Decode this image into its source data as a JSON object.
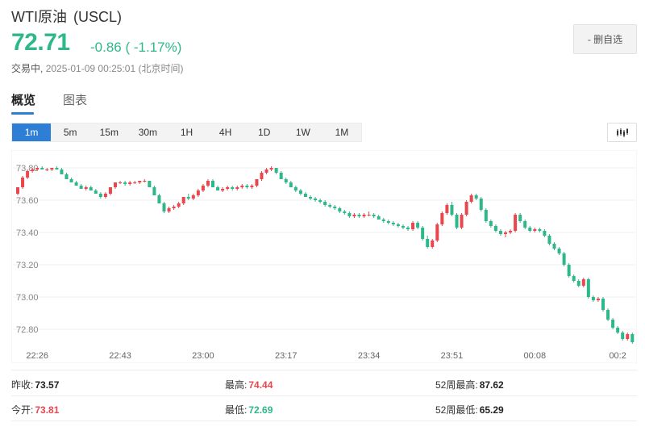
{
  "header": {
    "name": "WTI原油",
    "code": "(USCL)",
    "price": "72.71",
    "change": "-0.86 ( -1.17%)",
    "status": "交易中,",
    "timestamp": "2025-01-09 00:25:01 (北京时间)",
    "fav_label": "- 删自选"
  },
  "tabs": [
    {
      "label": "概览",
      "active": true
    },
    {
      "label": "图表",
      "active": false
    }
  ],
  "periods": [
    "1m",
    "5m",
    "15m",
    "30m",
    "1H",
    "4H",
    "1D",
    "1W",
    "1M"
  ],
  "active_period": "1m",
  "colors": {
    "up": "#e8474e",
    "down": "#2eb88a",
    "accent": "#2d7fd6"
  },
  "stats": {
    "prev_close_label": "昨收:",
    "prev_close": "73.57",
    "open_label": "今开:",
    "open": "73.81",
    "high_label": "最高:",
    "high": "74.44",
    "low_label": "最低:",
    "low": "72.69",
    "w52_high_label": "52周最高:",
    "w52_high": "87.62",
    "w52_low_label": "52周最低:",
    "w52_low": "65.29"
  },
  "chart_data": {
    "type": "candlestick",
    "y_ticks": [
      "73.80",
      "73.60",
      "73.40",
      "73.20",
      "73.00",
      "72.80"
    ],
    "y_tick_values": [
      73.8,
      73.6,
      73.4,
      73.2,
      73.0,
      72.8
    ],
    "ylim": [
      72.71,
      73.87
    ],
    "x_ticks": [
      "22:26",
      "22:43",
      "23:00",
      "23:17",
      "23:34",
      "23:51",
      "00:08",
      "00:2"
    ],
    "x_tick_index": [
      4,
      21,
      38,
      55,
      72,
      89,
      106,
      123
    ],
    "grid": true,
    "candles": [
      [
        73.64,
        73.68,
        73.63,
        73.68
      ],
      [
        73.68,
        73.75,
        73.67,
        73.74
      ],
      [
        73.74,
        73.79,
        73.73,
        73.78
      ],
      [
        73.78,
        73.8,
        73.77,
        73.79
      ],
      [
        73.79,
        73.8,
        73.78,
        73.8
      ],
      [
        73.8,
        73.81,
        73.79,
        73.79
      ],
      [
        73.79,
        73.8,
        73.78,
        73.79
      ],
      [
        73.79,
        73.8,
        73.78,
        73.8
      ],
      [
        73.8,
        73.81,
        73.79,
        73.79
      ],
      [
        73.79,
        73.8,
        73.76,
        73.76
      ],
      [
        73.76,
        73.77,
        73.73,
        73.73
      ],
      [
        73.73,
        73.74,
        73.71,
        73.71
      ],
      [
        73.71,
        73.72,
        73.69,
        73.69
      ],
      [
        73.69,
        73.7,
        73.67,
        73.67
      ],
      [
        73.67,
        73.69,
        73.66,
        73.68
      ],
      [
        73.68,
        73.69,
        73.66,
        73.66
      ],
      [
        73.66,
        73.67,
        73.64,
        73.64
      ],
      [
        73.64,
        73.65,
        73.61,
        73.62
      ],
      [
        73.62,
        73.65,
        73.61,
        73.64
      ],
      [
        73.64,
        73.68,
        73.63,
        73.68
      ],
      [
        73.68,
        73.71,
        73.67,
        73.71
      ],
      [
        73.71,
        73.72,
        73.7,
        73.71
      ],
      [
        73.71,
        73.72,
        73.69,
        73.7
      ],
      [
        73.7,
        73.72,
        73.69,
        73.71
      ],
      [
        73.71,
        73.72,
        73.7,
        73.71
      ],
      [
        73.71,
        73.72,
        73.7,
        73.72
      ],
      [
        73.72,
        73.73,
        73.71,
        73.72
      ],
      [
        73.72,
        73.72,
        73.68,
        73.68
      ],
      [
        73.68,
        73.69,
        73.63,
        73.63
      ],
      [
        73.63,
        73.64,
        73.58,
        73.58
      ],
      [
        73.58,
        73.59,
        73.52,
        73.53
      ],
      [
        73.53,
        73.56,
        73.52,
        73.55
      ],
      [
        73.55,
        73.57,
        73.54,
        73.56
      ],
      [
        73.56,
        73.59,
        73.55,
        73.58
      ],
      [
        73.58,
        73.62,
        73.57,
        73.62
      ],
      [
        73.62,
        73.64,
        73.6,
        73.61
      ],
      [
        73.61,
        73.64,
        73.6,
        73.63
      ],
      [
        73.63,
        73.67,
        73.62,
        73.66
      ],
      [
        73.66,
        73.7,
        73.65,
        73.69
      ],
      [
        73.69,
        73.73,
        73.68,
        73.72
      ],
      [
        73.72,
        73.73,
        73.68,
        73.68
      ],
      [
        73.68,
        73.69,
        73.66,
        73.66
      ],
      [
        73.66,
        73.68,
        73.65,
        73.67
      ],
      [
        73.67,
        73.69,
        73.66,
        73.68
      ],
      [
        73.68,
        73.69,
        73.66,
        73.67
      ],
      [
        73.67,
        73.69,
        73.66,
        73.68
      ],
      [
        73.68,
        73.7,
        73.67,
        73.69
      ],
      [
        73.69,
        73.7,
        73.67,
        73.68
      ],
      [
        73.68,
        73.7,
        73.67,
        73.69
      ],
      [
        73.69,
        73.73,
        73.68,
        73.73
      ],
      [
        73.73,
        73.78,
        73.72,
        73.77
      ],
      [
        73.77,
        73.8,
        73.76,
        73.79
      ],
      [
        73.79,
        73.81,
        73.78,
        73.8
      ],
      [
        73.8,
        73.8,
        73.76,
        73.77
      ],
      [
        73.77,
        73.78,
        73.73,
        73.73
      ],
      [
        73.73,
        73.74,
        73.7,
        73.71
      ],
      [
        73.71,
        73.72,
        73.68,
        73.68
      ],
      [
        73.68,
        73.69,
        73.65,
        73.66
      ],
      [
        73.66,
        73.67,
        73.63,
        73.64
      ],
      [
        73.64,
        73.65,
        73.62,
        73.62
      ],
      [
        73.62,
        73.63,
        73.6,
        73.61
      ],
      [
        73.61,
        73.62,
        73.59,
        73.6
      ],
      [
        73.6,
        73.61,
        73.58,
        73.59
      ],
      [
        73.59,
        73.6,
        73.56,
        73.57
      ],
      [
        73.57,
        73.58,
        73.55,
        73.56
      ],
      [
        73.56,
        73.57,
        73.54,
        73.55
      ],
      [
        73.55,
        73.56,
        73.52,
        73.53
      ],
      [
        73.53,
        73.54,
        73.51,
        73.52
      ],
      [
        73.52,
        73.53,
        73.49,
        73.5
      ],
      [
        73.5,
        73.52,
        73.49,
        73.51
      ],
      [
        73.51,
        73.52,
        73.49,
        73.5
      ],
      [
        73.5,
        73.52,
        73.49,
        73.51
      ],
      [
        73.51,
        73.53,
        73.5,
        73.51
      ],
      [
        73.51,
        73.52,
        73.49,
        73.5
      ],
      [
        73.5,
        73.51,
        73.48,
        73.48
      ],
      [
        73.48,
        73.49,
        73.46,
        73.47
      ],
      [
        73.47,
        73.48,
        73.45,
        73.46
      ],
      [
        73.46,
        73.47,
        73.44,
        73.45
      ],
      [
        73.45,
        73.46,
        73.43,
        73.44
      ],
      [
        73.44,
        73.45,
        73.42,
        73.43
      ],
      [
        73.43,
        73.44,
        73.41,
        73.42
      ],
      [
        73.42,
        73.47,
        73.41,
        73.46
      ],
      [
        73.46,
        73.47,
        73.42,
        73.43
      ],
      [
        73.43,
        73.44,
        73.35,
        73.36
      ],
      [
        73.36,
        73.38,
        73.3,
        73.31
      ],
      [
        73.31,
        73.36,
        73.3,
        73.35
      ],
      [
        73.35,
        73.46,
        73.34,
        73.45
      ],
      [
        73.45,
        73.53,
        73.44,
        73.52
      ],
      [
        73.52,
        73.58,
        73.51,
        73.57
      ],
      [
        73.57,
        73.59,
        73.5,
        73.51
      ],
      [
        73.51,
        73.52,
        73.42,
        73.43
      ],
      [
        73.43,
        73.52,
        73.42,
        73.51
      ],
      [
        73.51,
        73.6,
        73.5,
        73.59
      ],
      [
        73.59,
        73.64,
        73.58,
        73.63
      ],
      [
        73.63,
        73.64,
        73.6,
        73.61
      ],
      [
        73.61,
        73.62,
        73.53,
        73.54
      ],
      [
        73.54,
        73.55,
        73.46,
        73.47
      ],
      [
        73.47,
        73.48,
        73.43,
        73.44
      ],
      [
        73.44,
        73.45,
        73.4,
        73.41
      ],
      [
        73.41,
        73.42,
        73.38,
        73.39
      ],
      [
        73.39,
        73.41,
        73.37,
        73.4
      ],
      [
        73.4,
        73.42,
        73.39,
        73.41
      ],
      [
        73.41,
        73.52,
        73.4,
        73.51
      ],
      [
        73.51,
        73.52,
        73.46,
        73.47
      ],
      [
        73.47,
        73.48,
        73.42,
        73.43
      ],
      [
        73.43,
        73.44,
        73.4,
        73.41
      ],
      [
        73.41,
        73.43,
        73.4,
        73.42
      ],
      [
        73.42,
        73.43,
        73.4,
        73.41
      ],
      [
        73.41,
        73.42,
        73.37,
        73.38
      ],
      [
        73.38,
        73.39,
        73.32,
        73.33
      ],
      [
        73.33,
        73.34,
        73.29,
        73.3
      ],
      [
        73.3,
        73.31,
        73.26,
        73.27
      ],
      [
        73.27,
        73.28,
        73.19,
        73.2
      ],
      [
        73.2,
        73.21,
        73.12,
        73.13
      ],
      [
        73.13,
        73.14,
        73.09,
        73.1
      ],
      [
        73.1,
        73.11,
        73.06,
        73.07
      ],
      [
        73.07,
        73.12,
        73.06,
        73.11
      ],
      [
        73.11,
        73.12,
        72.99,
        73.0
      ],
      [
        73.0,
        73.01,
        72.97,
        72.98
      ],
      [
        72.98,
        73.0,
        72.97,
        72.99
      ],
      [
        72.99,
        73.0,
        72.91,
        72.92
      ],
      [
        72.92,
        72.93,
        72.85,
        72.86
      ],
      [
        72.86,
        72.87,
        72.8,
        72.81
      ],
      [
        72.81,
        72.82,
        72.77,
        72.78
      ],
      [
        72.78,
        72.79,
        72.73,
        72.74
      ],
      [
        72.74,
        72.78,
        72.73,
        72.77
      ],
      [
        72.77,
        72.78,
        72.71,
        72.72
      ]
    ]
  }
}
